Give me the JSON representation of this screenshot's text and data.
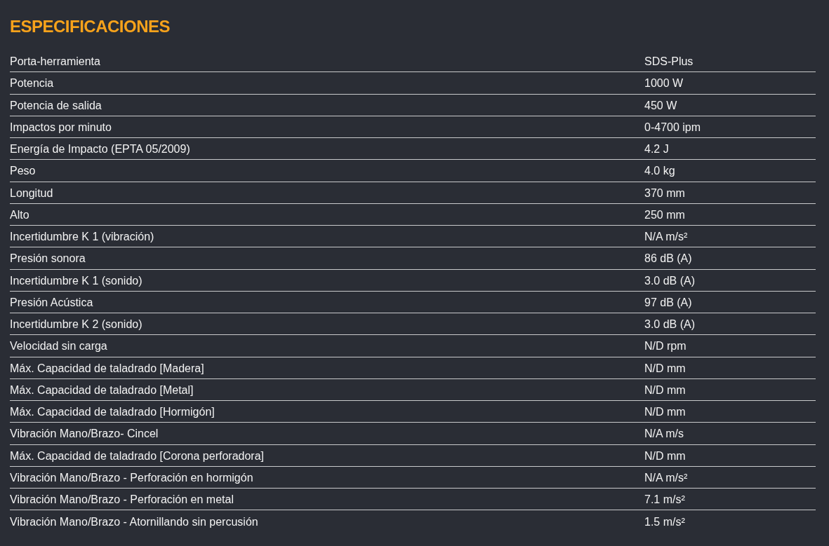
{
  "title": "ESPECIFICACIONES",
  "specs": [
    {
      "name": "Porta-herramienta",
      "value": "SDS-Plus"
    },
    {
      "name": "Potencia",
      "value": "1000 W"
    },
    {
      "name": "Potencia de salida",
      "value": "450 W"
    },
    {
      "name": "Impactos por minuto",
      "value": "0-4700 ipm"
    },
    {
      "name": "Energía de Impacto (EPTA 05/2009)",
      "value": "4.2 J"
    },
    {
      "name": "Peso",
      "value": "4.0 kg"
    },
    {
      "name": "Longitud",
      "value": "370 mm"
    },
    {
      "name": "Alto",
      "value": "250 mm"
    },
    {
      "name": "Incertidumbre K 1 (vibración)",
      "value": "N/A m/s²"
    },
    {
      "name": "Presión sonora",
      "value": "86 dB (A)"
    },
    {
      "name": "Incertidumbre K 1 (sonido)",
      "value": "3.0 dB (A)"
    },
    {
      "name": "Presión Acústica",
      "value": "97 dB (A)"
    },
    {
      "name": "Incertidumbre K 2 (sonido)",
      "value": "3.0 dB (A)"
    },
    {
      "name": "Velocidad sin carga",
      "value": "N/D rpm"
    },
    {
      "name": "Máx. Capacidad de taladrado [Madera]",
      "value": "N/D mm"
    },
    {
      "name": "Máx. Capacidad de taladrado [Metal]",
      "value": "N/D mm"
    },
    {
      "name": "Máx. Capacidad de taladrado [Hormigón]",
      "value": "N/D mm"
    },
    {
      "name": "Vibración Mano/Brazo- Cincel",
      "value": "N/A m/s"
    },
    {
      "name": "Máx. Capacidad de taladrado [Corona perforadora]",
      "value": "N/D mm"
    },
    {
      "name": "Vibración Mano/Brazo - Perforación en hormigón",
      "value": "N/A m/s²"
    },
    {
      "name": "Vibración Mano/Brazo - Perforación en metal",
      "value": "7.1 m/s²"
    },
    {
      "name": "Vibración Mano/Brazo - Atornillando sin percusión",
      "value": "1.5 m/s²"
    }
  ]
}
